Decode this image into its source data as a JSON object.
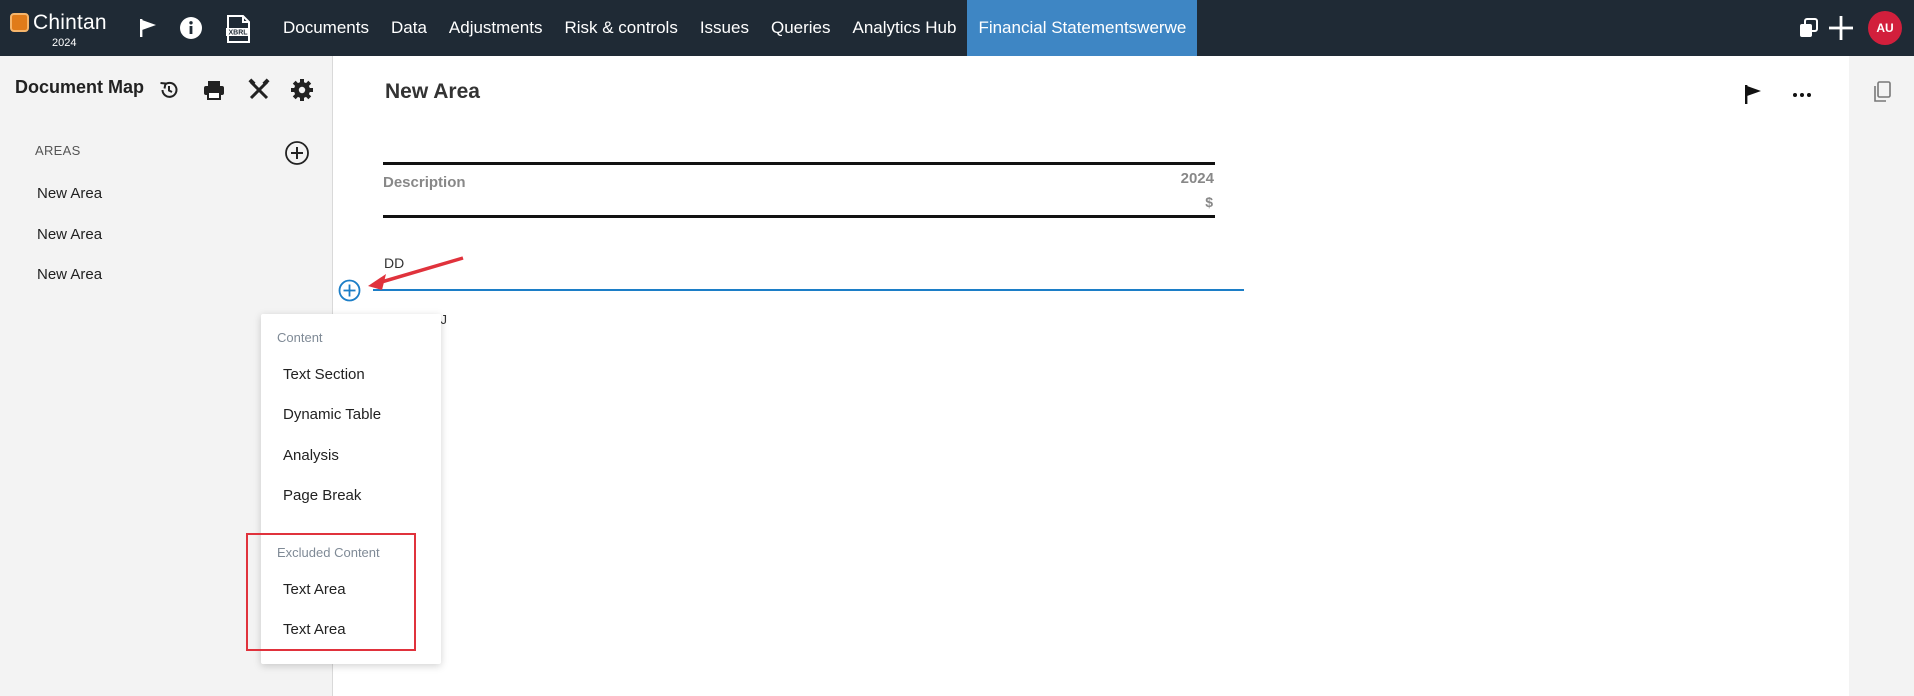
{
  "app": {
    "name": "Chintan",
    "year": "2024",
    "accent_color": "#3e86c4",
    "brand_color": "#e07b1a"
  },
  "topbar": {
    "icons": [
      "flag-icon",
      "info-icon",
      "xbrl-icon"
    ],
    "xbrl_label": "XBRL",
    "nav": [
      {
        "label": "Documents"
      },
      {
        "label": "Data"
      },
      {
        "label": "Adjustments"
      },
      {
        "label": "Risk & controls"
      },
      {
        "label": "Issues"
      },
      {
        "label": "Queries"
      },
      {
        "label": "Analytics Hub"
      },
      {
        "label": "Financial Statementswerwe",
        "active": true
      }
    ],
    "right_icons": [
      "windows-icon",
      "plus-icon"
    ],
    "avatar_initials": "AU",
    "avatar_color": "#d21f3c"
  },
  "sidebar": {
    "title": "Document Map",
    "tools": [
      "history-icon",
      "print-icon",
      "tools-icon",
      "gear-icon"
    ],
    "areas_label": "AREAS",
    "areas": [
      {
        "label": "New Area"
      },
      {
        "label": "New Area"
      },
      {
        "label": "New Area"
      }
    ]
  },
  "main": {
    "title": "New Area",
    "icons": [
      "flag-icon",
      "more-icon"
    ],
    "table": {
      "description_header": "Description",
      "year_header": "2024",
      "unit_header": "$",
      "rows": [
        {
          "label": "DD"
        },
        {
          "label": "JJ"
        }
      ]
    }
  },
  "menu": {
    "sections": [
      {
        "title": "Content",
        "items": [
          "Text Section",
          "Dynamic Table",
          "Analysis",
          "Page Break"
        ]
      },
      {
        "title": "Excluded Content",
        "items": [
          "Text Area",
          "Text Area"
        ]
      }
    ]
  },
  "annotation_color": "#e0323c"
}
